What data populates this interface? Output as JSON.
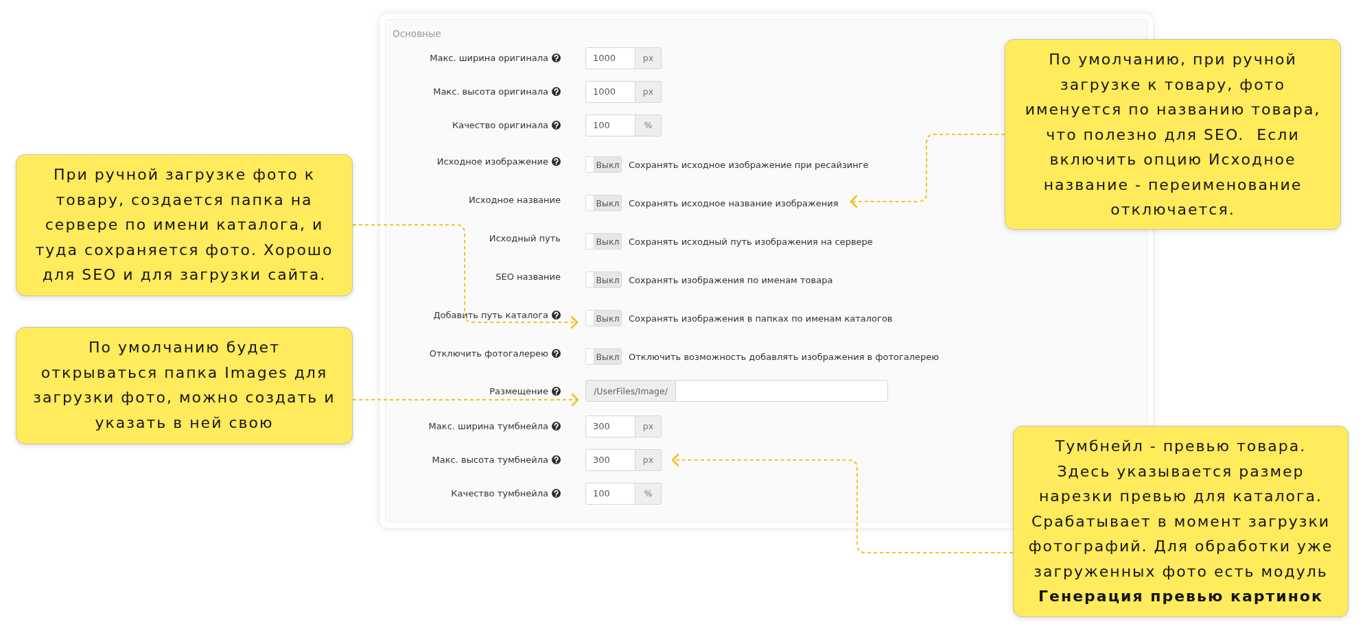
{
  "panel": {
    "legend": "Основные",
    "rows": [
      {
        "kind": "number",
        "label": "Макс. ширина оригинала",
        "help": true,
        "value": "1000",
        "unit": "px"
      },
      {
        "kind": "number",
        "label": "Макс. высота оригинала",
        "help": true,
        "value": "1000",
        "unit": "px"
      },
      {
        "kind": "number",
        "label": "Качество оригинала",
        "help": true,
        "value": "100",
        "unit": "%"
      },
      {
        "kind": "toggle",
        "label": "Исходное изображение",
        "help": true,
        "on": false,
        "switch_text": "Выкл",
        "description": "Сохранять исходное изображение при ресайзинге"
      },
      {
        "kind": "toggle",
        "label": "Исходное название",
        "help": false,
        "on": false,
        "switch_text": "Выкл",
        "description": "Сохранять исходное название изображения"
      },
      {
        "kind": "toggle",
        "label": "Исходный путь",
        "help": false,
        "on": false,
        "switch_text": "Выкл",
        "description": "Сохранять исходный путь изображения на сервере"
      },
      {
        "kind": "toggle",
        "label": "SEO название",
        "help": false,
        "on": false,
        "switch_text": "Выкл",
        "description": "Сохранять изображения по именам товара"
      },
      {
        "kind": "toggle",
        "label": "Добавить путь каталога",
        "help": true,
        "on": false,
        "switch_text": "Выкл",
        "description": "Сохранять изображения в папках по именам каталогов"
      },
      {
        "kind": "toggle",
        "label": "Отключить фотогалерею",
        "help": true,
        "on": false,
        "switch_text": "Выкл",
        "description": "Отключить возможность добавлять изображения в фотогалерею"
      },
      {
        "kind": "path",
        "label": "Размещение",
        "help": true,
        "prefix": "/UserFiles/Image/"
      },
      {
        "kind": "number",
        "label": "Макс. ширина тумбнейла",
        "help": true,
        "value": "300",
        "unit": "px"
      },
      {
        "kind": "number",
        "label": "Макс. высота тумбнейла",
        "help": true,
        "value": "300",
        "unit": "px"
      },
      {
        "kind": "number",
        "label": "Качество тумбнейла",
        "help": true,
        "value": "100",
        "unit": "%"
      }
    ]
  },
  "callouts": [
    {
      "text": "По умолчанию, при ручной\nзагрузке к товару, фото\nименуется по названию товара,\nчто полезно для SEO.  Если\nвключить опцию Исходное\nназвание - переименование\nотключается."
    },
    {
      "text": "При ручной загрузке фото к\nтовару, создается папка на\nсервере по имени каталога, и\nтуда сохраняется фото. Хорошо\nдля SEO и для загрузки сайта."
    },
    {
      "text": "По умолчанию будет\nоткрываться папка Images для\nзагрузки фото, можно создать и\nуказать в ней свою"
    },
    {
      "text": "Тумбнейл - превью товара.\nЗдесь указывается размер\nнарезки превью для каталога.\nСрабатывает в момент загрузки\nфотографий. Для обработки уже\nзагруженных фото есть модуль\n**Генерация превью картинок**"
    }
  ]
}
